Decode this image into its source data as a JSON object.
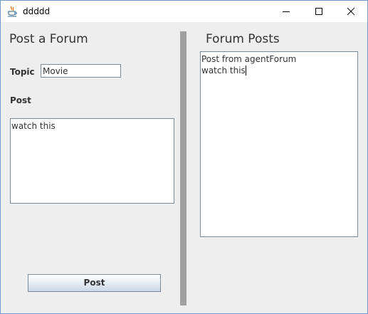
{
  "window": {
    "title": "ddddd",
    "app_icon": "java-coffee-cup-icon",
    "controls": [
      "minimize-icon",
      "maximize-icon",
      "close-icon"
    ]
  },
  "left_panel": {
    "heading": "Post a Forum",
    "topic_label": "Topic",
    "topic_value": "Movie",
    "post_label": "Post",
    "post_text": "watch this",
    "post_button": "Post"
  },
  "right_panel": {
    "heading": "Forum Posts",
    "lines": [
      "Post from agentForum",
      "watch this"
    ]
  },
  "colors": {
    "window_bg": "#eeeeee",
    "divider": "#a0a0a0",
    "text": "#333333",
    "border": "#7a8a99"
  }
}
